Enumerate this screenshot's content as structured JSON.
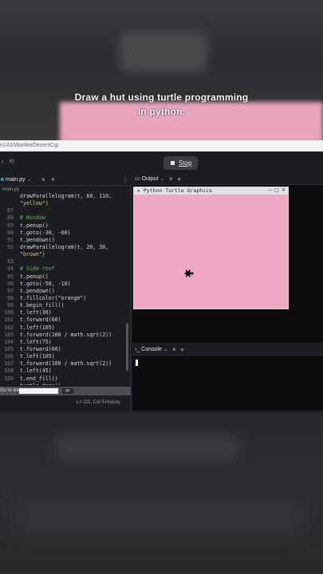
{
  "caption": {
    "line1": "Draw a hut using turtle programming",
    "line2": "In python."
  },
  "url": "n143/WarlikeDecentCgi",
  "toolbar": {
    "back": "‹",
    "refresh": "⟲",
    "run_label": "Stop"
  },
  "editor": {
    "tab_label": "main.py",
    "tab_close": "×",
    "tab_add": "+",
    "tab_more": "⋮",
    "breadcrumb": "main.py",
    "lines": [
      {
        "n": "",
        "text": "drawParallelogram(t, 60, 110,"
      },
      {
        "n": "",
        "text": "\"yellow\")"
      },
      {
        "n": "87",
        "text": ""
      },
      {
        "n": "88",
        "text": "# Window"
      },
      {
        "n": "89",
        "text": "t.penup()"
      },
      {
        "n": "90",
        "text": "t.goto(-30, -60)"
      },
      {
        "n": "91",
        "text": "t.pendown()"
      },
      {
        "n": "92",
        "text": "drawParallelogram(t, 20, 30,"
      },
      {
        "n": "",
        "text": "\"brown\")"
      },
      {
        "n": "93",
        "text": ""
      },
      {
        "n": "94",
        "text": "# Side roof"
      },
      {
        "n": "95",
        "text": "t.penup()"
      },
      {
        "n": "96",
        "text": "t.goto(-50, -10)"
      },
      {
        "n": "97",
        "text": "t.pendown()"
      },
      {
        "n": "98",
        "text": "t.fillcolor(\"orange\")"
      },
      {
        "n": "99",
        "text": "t.begin_fill()"
      },
      {
        "n": "100",
        "text": "t.left(30)"
      },
      {
        "n": "101",
        "text": "t.forward(60)"
      },
      {
        "n": "102",
        "text": "t.left(105)"
      },
      {
        "n": "103",
        "text": "t.forward(100 / math.sqrt(2))"
      },
      {
        "n": "104",
        "text": "t.left(75)"
      },
      {
        "n": "105",
        "text": "t.forward(60)"
      },
      {
        "n": "106",
        "text": "t.left(105)"
      },
      {
        "n": "107",
        "text": "t.forward(100 / math.sqrt(2))"
      },
      {
        "n": "108",
        "text": "t.left(45)"
      },
      {
        "n": "109",
        "text": "t.end_fill()"
      },
      {
        "n": "",
        "text": "turtle.done()"
      }
    ],
    "find_label": "Go to line",
    "find_button": "go",
    "status_position": "Ln 111, Col 5",
    "status_history": "History"
  },
  "output": {
    "tab_label": "Output",
    "tab_close": "×",
    "tab_add": "+",
    "window_title": "Python Turtle Graphics",
    "canvas_color": "#efa8c4"
  },
  "console": {
    "tab_label": "Console",
    "tab_close": "×",
    "tab_add": "+"
  }
}
